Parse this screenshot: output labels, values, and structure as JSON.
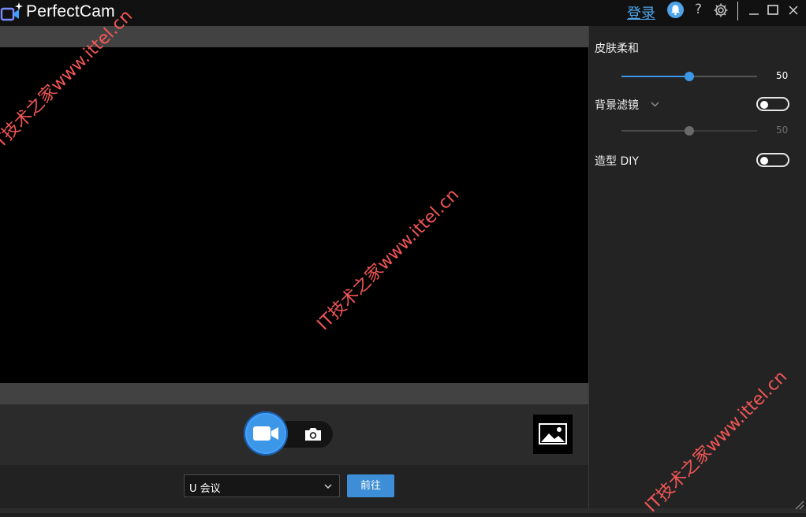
{
  "titlebar": {
    "app_name": "PerfectCam",
    "login_label": "登录",
    "help_label": "?"
  },
  "controls": {
    "mode_selected": "video",
    "app_select_value": "U 会议",
    "go_button": "前往"
  },
  "side_panel": {
    "skin_smooth": {
      "label": "皮肤柔和",
      "value": "50",
      "level": 0.5,
      "enabled": true
    },
    "bg_filter": {
      "label": "背景滤镜",
      "value": "50",
      "level": 0.5,
      "enabled": false
    },
    "style_diy": {
      "label": "造型 DIY",
      "enabled": false
    }
  },
  "watermark": {
    "text": "IT技术之家www.ittel.cn"
  },
  "colors": {
    "accent": "#3d97e8",
    "titlebar_bg": "#111111",
    "panel_bg": "#232323",
    "watermark": "#ff5a5a"
  }
}
